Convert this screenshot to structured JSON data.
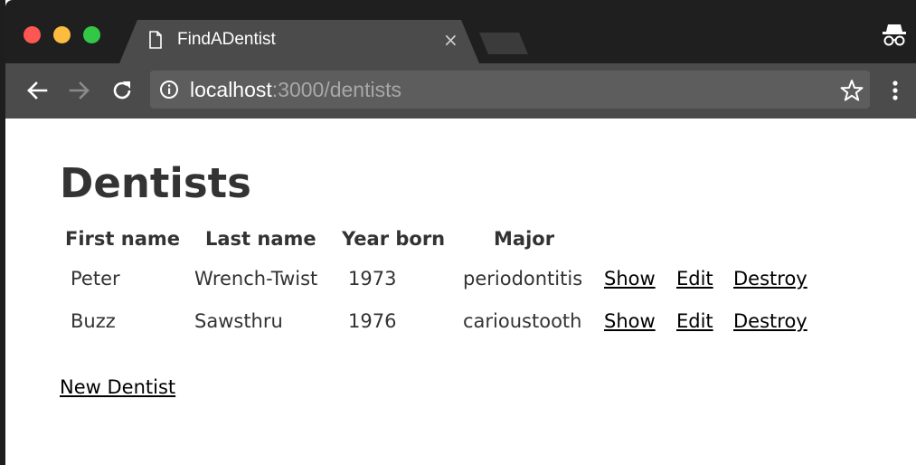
{
  "browser": {
    "tab_title": "FindADentist",
    "tab_close": "×",
    "url_host": "localhost",
    "url_rest": ":3000/dentists",
    "icons": {
      "back": "arrow-left-icon",
      "forward": "arrow-right-icon",
      "reload": "reload-icon",
      "info": "info-icon",
      "bookmark": "star-icon",
      "menu": "kebab-menu-icon",
      "incognito": "incognito-icon",
      "tab_page": "document-icon"
    },
    "colors": {
      "close": "#fc5753",
      "minimize": "#fdbc40",
      "zoom": "#33c748"
    }
  },
  "page": {
    "title": "Dentists",
    "table": {
      "headers": [
        "First name",
        "Last name",
        "Year born",
        "Major"
      ],
      "rows": [
        {
          "first_name": "Peter",
          "last_name": "Wrench-Twist",
          "year_born": "1973",
          "major": "periodontitis",
          "show": "Show",
          "edit": "Edit",
          "destroy": "Destroy"
        },
        {
          "first_name": "Buzz",
          "last_name": "Sawsthru",
          "year_born": "1976",
          "major": "carioustooth",
          "show": "Show",
          "edit": "Edit",
          "destroy": "Destroy"
        }
      ]
    },
    "new_link": "New Dentist"
  }
}
